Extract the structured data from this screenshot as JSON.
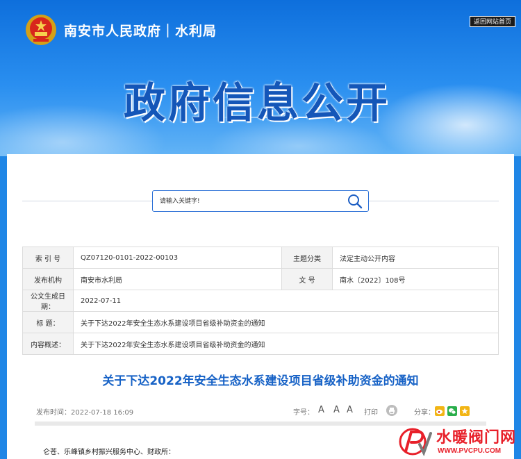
{
  "header": {
    "site_title": "南安市人民政府｜水利局",
    "home_link": "返回网站首页",
    "banner_title": "政府信息公开"
  },
  "search": {
    "placeholder": "请输入关键字!"
  },
  "meta": {
    "index_label": "索 引 号",
    "index_value": "QZ07120-0101-2022-00103",
    "topic_label": "主题分类",
    "topic_value": "法定主动公开内容",
    "publisher_label": "发布机构",
    "publisher_value": "南安市水利局",
    "docno_label": "文 号",
    "docno_value": "南水〔2022〕108号",
    "date_label": "公文生成日期：",
    "date_value": "2022-07-11",
    "title_label": "标 题：",
    "title_value": "关于下达2022年安全生态水系建设项目省级补助资金的通知",
    "summary_label": "内容概述：",
    "summary_value": "关于下达2022年安全生态水系建设项目省级补助资金的通知"
  },
  "article": {
    "title": "关于下达2022年安全生态水系建设项目省级补助资金的通知",
    "pub_time": "发布时间：2022-07-18 16:09",
    "font_size_label": "字号：",
    "font_large": "A",
    "font_medium": "A",
    "font_small": "A",
    "print_label": "打印",
    "share_label": "分享：",
    "body_first_line": "仑苍、乐峰镇乡村振兴服务中心、财政所："
  },
  "watermark": {
    "name": "水暖阀门网",
    "url": "WWW.PVCPU.COM"
  },
  "colors": {
    "accent": "#1762c6",
    "banner_title": "#1456b8",
    "watermark": "#e8202a"
  }
}
